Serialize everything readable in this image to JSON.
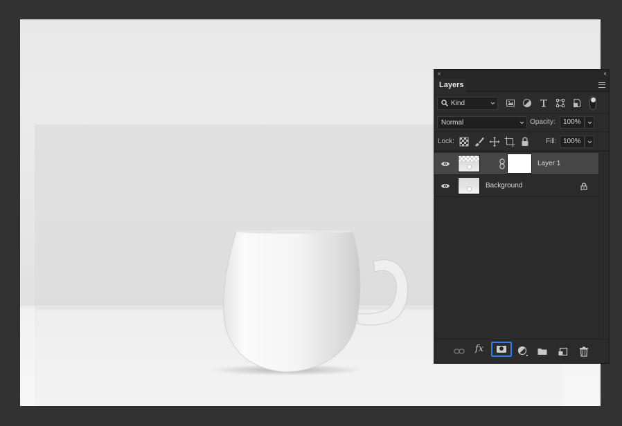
{
  "canvas": {
    "image_subject": "white coffee mug on white table"
  },
  "panel": {
    "title": "Layers",
    "close_icon": "×",
    "collapse_icon": "‹‹",
    "filter": {
      "kind_label": "Kind"
    },
    "blend": {
      "mode": "Normal",
      "opacity_label": "Opacity:",
      "opacity_value": "100%"
    },
    "lock": {
      "lock_label": "Lock:",
      "fill_label": "Fill:",
      "fill_value": "100%"
    },
    "layers": [
      {
        "name": "Layer 1",
        "selected": true,
        "visible": true,
        "has_mask": true
      },
      {
        "name": "Background",
        "selected": false,
        "visible": true,
        "locked": true
      }
    ],
    "bottom": {
      "fx_label": "fx"
    }
  },
  "colors": {
    "panel_bg": "#2b2b2b",
    "selected_row": "#474747",
    "accent_blue": "#2d7ff9",
    "app_bg": "#323232"
  }
}
